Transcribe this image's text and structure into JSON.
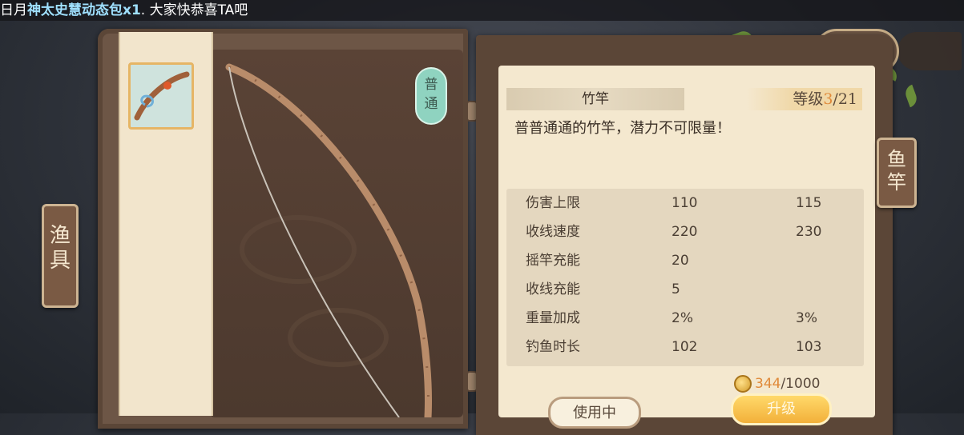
{
  "banner": {
    "prefix": "日月",
    "highlight": "神太史慧动态包x1",
    "suffix": ". 大家快恭喜TA吧"
  },
  "left_tab": {
    "label": "渔具"
  },
  "right_tab": {
    "label": "鱼竿"
  },
  "item": {
    "rarity": "普通",
    "name": "竹竿",
    "level_label": "等级",
    "level_current": "3",
    "level_max": "/21",
    "description": "普普通通的竹竿，潜力不可限量！"
  },
  "stats": [
    {
      "name": "伤害上限",
      "current": "110",
      "next": "115"
    },
    {
      "name": "收线速度",
      "current": "220",
      "next": "230"
    },
    {
      "name": "摇竿充能",
      "current": "20",
      "next": ""
    },
    {
      "name": "收线充能",
      "current": "5",
      "next": ""
    },
    {
      "name": "重量加成",
      "current": "2%",
      "next": "3%"
    },
    {
      "name": "钓鱼时长",
      "current": "102",
      "next": "103"
    }
  ],
  "cost": {
    "have": "344",
    "need": "/1000"
  },
  "buttons": {
    "using": "使用中",
    "upgrade": "升级"
  },
  "colors": {
    "accent": "#e08a3a",
    "arrow": "#e8b23a",
    "rarity": "#8fd3c0"
  },
  "icons": [
    "fishing-rod-icon",
    "coin-icon",
    "play-arrow-icon",
    "fish-back-arrow-icon"
  ]
}
